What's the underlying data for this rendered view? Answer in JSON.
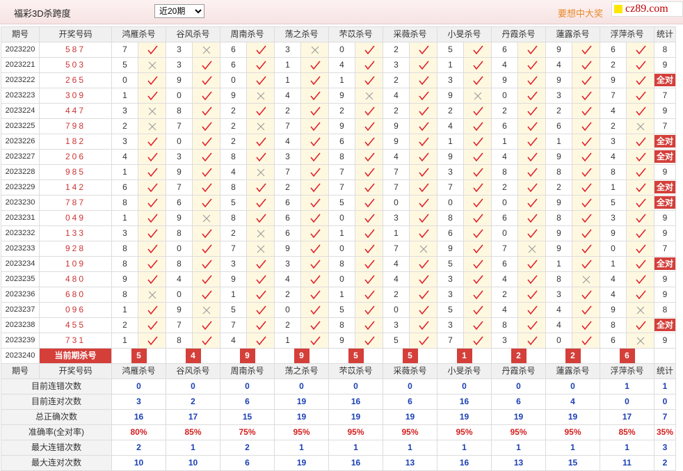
{
  "header": {
    "title": "福彩3D杀跨度",
    "period_selected": "近20期",
    "period_options": [
      "近20期"
    ],
    "slogan": "要想中大奖",
    "logo_text": "cz89.com"
  },
  "table": {
    "col_period": "期号",
    "col_draw": "开奖号码",
    "col_stat": "统计",
    "experts": [
      "鸿雁杀号",
      "谷风杀号",
      "周南杀号",
      "荡之杀号",
      "芣苡杀号",
      "采薇杀号",
      "小旻杀号",
      "丹霞杀号",
      "蓮露杀号",
      "浮萍杀号"
    ],
    "rows": [
      {
        "period": "2023220",
        "draw": "587",
        "kills": [
          7,
          3,
          6,
          3,
          0,
          2,
          5,
          6,
          9,
          6
        ],
        "hits": [
          1,
          0,
          1,
          0,
          1,
          1,
          1,
          1,
          1,
          1
        ],
        "stat": "8"
      },
      {
        "period": "2023221",
        "draw": "503",
        "kills": [
          5,
          3,
          6,
          1,
          4,
          3,
          1,
          4,
          4,
          2
        ],
        "hits": [
          0,
          1,
          1,
          1,
          1,
          1,
          1,
          1,
          1,
          1
        ],
        "stat": "9"
      },
      {
        "period": "2023222",
        "draw": "265",
        "kills": [
          0,
          9,
          0,
          1,
          1,
          2,
          3,
          9,
          9,
          9
        ],
        "hits": [
          1,
          1,
          1,
          1,
          1,
          1,
          1,
          1,
          1,
          1
        ],
        "stat": "全对"
      },
      {
        "period": "2023223",
        "draw": "309",
        "kills": [
          1,
          0,
          9,
          4,
          9,
          4,
          9,
          0,
          3,
          7
        ],
        "hits": [
          1,
          1,
          0,
          1,
          0,
          1,
          0,
          1,
          1,
          1
        ],
        "stat": "7"
      },
      {
        "period": "2023224",
        "draw": "447",
        "kills": [
          3,
          8,
          2,
          2,
          2,
          2,
          2,
          2,
          2,
          4
        ],
        "hits": [
          0,
          1,
          1,
          1,
          1,
          1,
          1,
          1,
          1,
          1
        ],
        "stat": "9"
      },
      {
        "period": "2023225",
        "draw": "798",
        "kills": [
          2,
          7,
          2,
          7,
          9,
          9,
          4,
          6,
          6,
          2
        ],
        "hits": [
          0,
          1,
          0,
          1,
          1,
          1,
          1,
          1,
          1,
          0
        ],
        "stat": "7"
      },
      {
        "period": "2023226",
        "draw": "182",
        "kills": [
          3,
          0,
          2,
          4,
          6,
          9,
          1,
          1,
          1,
          3
        ],
        "hits": [
          1,
          1,
          1,
          1,
          1,
          1,
          1,
          1,
          1,
          1
        ],
        "stat": "全对"
      },
      {
        "period": "2023227",
        "draw": "206",
        "kills": [
          4,
          3,
          8,
          3,
          8,
          4,
          9,
          4,
          9,
          4
        ],
        "hits": [
          1,
          1,
          1,
          1,
          1,
          1,
          1,
          1,
          1,
          1
        ],
        "stat": "全对"
      },
      {
        "period": "2023228",
        "draw": "985",
        "kills": [
          1,
          9,
          4,
          7,
          7,
          7,
          3,
          8,
          8,
          8
        ],
        "hits": [
          1,
          1,
          0,
          1,
          1,
          1,
          1,
          1,
          1,
          1
        ],
        "stat": "9"
      },
      {
        "period": "2023229",
        "draw": "142",
        "kills": [
          6,
          7,
          8,
          2,
          7,
          7,
          7,
          2,
          2,
          1
        ],
        "hits": [
          1,
          1,
          1,
          1,
          1,
          1,
          1,
          1,
          1,
          1
        ],
        "stat": "全对"
      },
      {
        "period": "2023230",
        "draw": "787",
        "kills": [
          8,
          6,
          5,
          6,
          5,
          0,
          0,
          0,
          9,
          5
        ],
        "hits": [
          1,
          1,
          1,
          1,
          1,
          1,
          1,
          1,
          1,
          1
        ],
        "stat": "全对"
      },
      {
        "period": "2023231",
        "draw": "049",
        "kills": [
          1,
          9,
          8,
          6,
          0,
          3,
          8,
          6,
          8,
          3
        ],
        "hits": [
          1,
          0,
          1,
          1,
          1,
          1,
          1,
          1,
          1,
          1
        ],
        "stat": "9"
      },
      {
        "period": "2023232",
        "draw": "133",
        "kills": [
          3,
          8,
          2,
          6,
          1,
          1,
          6,
          0,
          9,
          9
        ],
        "hits": [
          1,
          1,
          0,
          1,
          1,
          1,
          1,
          1,
          1,
          1
        ],
        "stat": "9"
      },
      {
        "period": "2023233",
        "draw": "928",
        "kills": [
          8,
          0,
          7,
          9,
          0,
          7,
          9,
          7,
          9,
          0
        ],
        "hits": [
          1,
          1,
          0,
          1,
          1,
          0,
          1,
          0,
          1,
          1
        ],
        "stat": "7"
      },
      {
        "period": "2023234",
        "draw": "109",
        "kills": [
          8,
          8,
          3,
          3,
          8,
          4,
          5,
          6,
          1,
          1
        ],
        "hits": [
          1,
          1,
          1,
          1,
          1,
          1,
          1,
          1,
          1,
          1
        ],
        "stat": "全对"
      },
      {
        "period": "2023235",
        "draw": "480",
        "kills": [
          9,
          4,
          9,
          4,
          0,
          4,
          3,
          4,
          8,
          4
        ],
        "hits": [
          1,
          1,
          1,
          1,
          1,
          1,
          1,
          1,
          0,
          1
        ],
        "stat": "9"
      },
      {
        "period": "2023236",
        "draw": "680",
        "kills": [
          8,
          0,
          1,
          2,
          1,
          2,
          3,
          2,
          3,
          4
        ],
        "hits": [
          0,
          1,
          1,
          1,
          1,
          1,
          1,
          1,
          1,
          1
        ],
        "stat": "9"
      },
      {
        "period": "2023237",
        "draw": "096",
        "kills": [
          1,
          9,
          5,
          0,
          5,
          0,
          5,
          4,
          4,
          9
        ],
        "hits": [
          1,
          0,
          1,
          1,
          1,
          1,
          1,
          1,
          1,
          0
        ],
        "stat": "8"
      },
      {
        "period": "2023238",
        "draw": "455",
        "kills": [
          2,
          7,
          7,
          2,
          8,
          3,
          3,
          8,
          4,
          8
        ],
        "hits": [
          1,
          1,
          1,
          1,
          1,
          1,
          1,
          1,
          1,
          1
        ],
        "stat": "全对"
      },
      {
        "period": "2023239",
        "draw": "731",
        "kills": [
          1,
          8,
          4,
          1,
          9,
          5,
          7,
          3,
          0,
          6
        ],
        "hits": [
          1,
          1,
          1,
          1,
          1,
          1,
          1,
          1,
          1,
          0
        ],
        "stat": "9"
      }
    ],
    "current": {
      "period": "2023240",
      "label": "当前期杀号",
      "kills": [
        5,
        4,
        9,
        9,
        5,
        5,
        1,
        2,
        2,
        6
      ]
    }
  },
  "stats": {
    "labels": [
      "目前连错次数",
      "目前连对次数",
      "总正确次数",
      "准确率(全对率)",
      "最大连错次数",
      "最大连对次数"
    ],
    "rate_row_index": 3,
    "values": [
      [
        "0",
        "0",
        "0",
        "0",
        "0",
        "0",
        "0",
        "0",
        "0",
        "1",
        "1"
      ],
      [
        "3",
        "2",
        "6",
        "19",
        "16",
        "6",
        "16",
        "6",
        "4",
        "0",
        "0"
      ],
      [
        "16",
        "17",
        "15",
        "19",
        "19",
        "19",
        "19",
        "19",
        "19",
        "17",
        "7"
      ],
      [
        "80%",
        "85%",
        "75%",
        "95%",
        "95%",
        "95%",
        "95%",
        "95%",
        "95%",
        "85%",
        "35%"
      ],
      [
        "2",
        "1",
        "2",
        "1",
        "1",
        "1",
        "1",
        "1",
        "1",
        "1",
        "3"
      ],
      [
        "10",
        "10",
        "6",
        "19",
        "16",
        "13",
        "16",
        "13",
        "15",
        "11",
        "2"
      ]
    ]
  },
  "colors": {
    "check": "#e0212b",
    "cross": "#999999",
    "badge": "#d43f3a",
    "stat_blue": "#1a3fb5",
    "rate_red": "#d42020",
    "mark_bg": "#fff8e1"
  }
}
